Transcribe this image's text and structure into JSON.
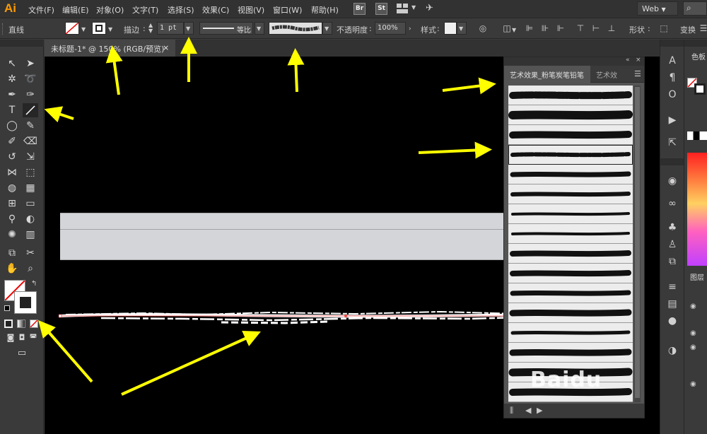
{
  "app": {
    "logo": "Ai"
  },
  "menu": {
    "items": [
      "文件(F)",
      "编辑(E)",
      "对象(O)",
      "文字(T)",
      "选择(S)",
      "效果(C)",
      "视图(V)",
      "窗口(W)",
      "帮助(H)"
    ],
    "bridge_label": "Br",
    "stock_label": "St",
    "workspace": "Web"
  },
  "control": {
    "object_type": "直线",
    "stroke_label": "描边",
    "stroke_weight": "1 pt",
    "profile_label": "等比",
    "opacity_label": "不透明度",
    "opacity_value": "100%",
    "style_label": "样式",
    "shape_label": "形状",
    "transform_label": "变换"
  },
  "document": {
    "tab_title": "未标题-1* @ 150% (RGB/预览)",
    "close_glyph": "×"
  },
  "brush_panel": {
    "tab_active": "艺术效果_粉笔炭笔铅笔",
    "tab_other": "艺术效",
    "selected_index": 3,
    "brush_count": 16
  },
  "right_dock": {
    "color_label": "色板",
    "layers_label": "图层"
  },
  "watermark": "Baidu",
  "colors": {
    "accent": "#ff9a00",
    "arrow": "#ffff00",
    "canvas": "#000000"
  }
}
